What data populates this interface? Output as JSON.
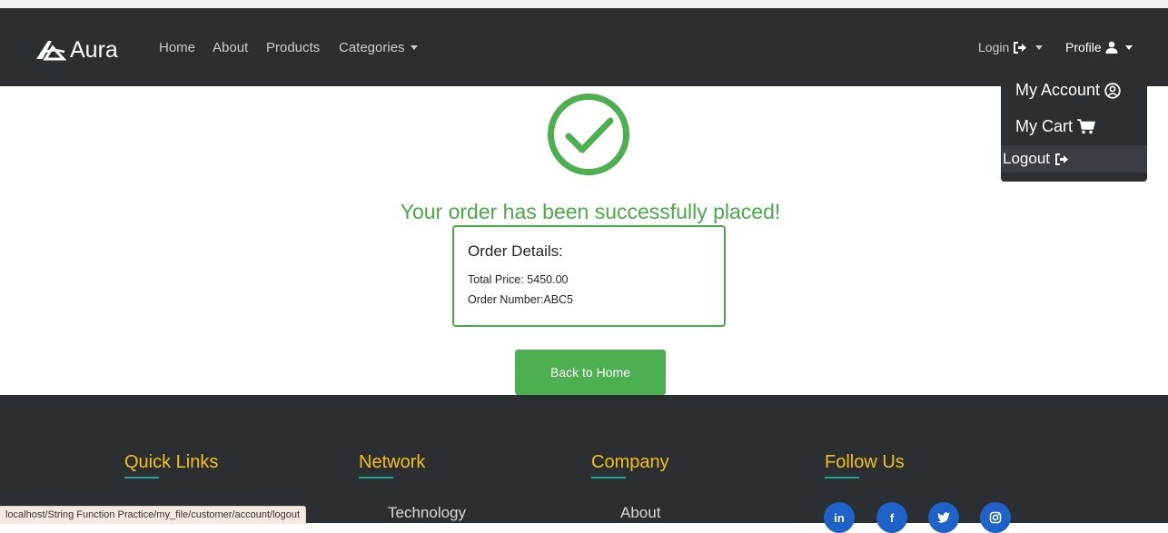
{
  "navbar": {
    "brand": "Aura",
    "links": [
      "Home",
      "About",
      "Products",
      "Categories"
    ],
    "login_label": "Login",
    "profile_label": "Profile"
  },
  "profile_menu": {
    "items": [
      "My Account",
      "My Cart",
      "Logout"
    ]
  },
  "main": {
    "success_message": "Your order has been successfully placed!",
    "order_details": {
      "title": "Order Details:",
      "total_price": "Total Price: 5450.00",
      "order_number": "Order Number:ABC5"
    },
    "back_button": "Back to Home"
  },
  "footer": {
    "sections": [
      {
        "heading": "Quick Links",
        "first_link": ""
      },
      {
        "heading": "Network",
        "first_link": "Technology"
      },
      {
        "heading": "Company",
        "first_link": "About"
      },
      {
        "heading": "Follow Us"
      }
    ],
    "social": [
      "in",
      "f"
    ]
  },
  "status_bar": {
    "url": "localhost/String Function Practice/my_file/customer/account/logout"
  },
  "colors": {
    "navbar_bg": "#2b2f32",
    "success_green": "#4caf50",
    "footer_heading": "#f5c016",
    "social_blue": "#1d61c9"
  }
}
